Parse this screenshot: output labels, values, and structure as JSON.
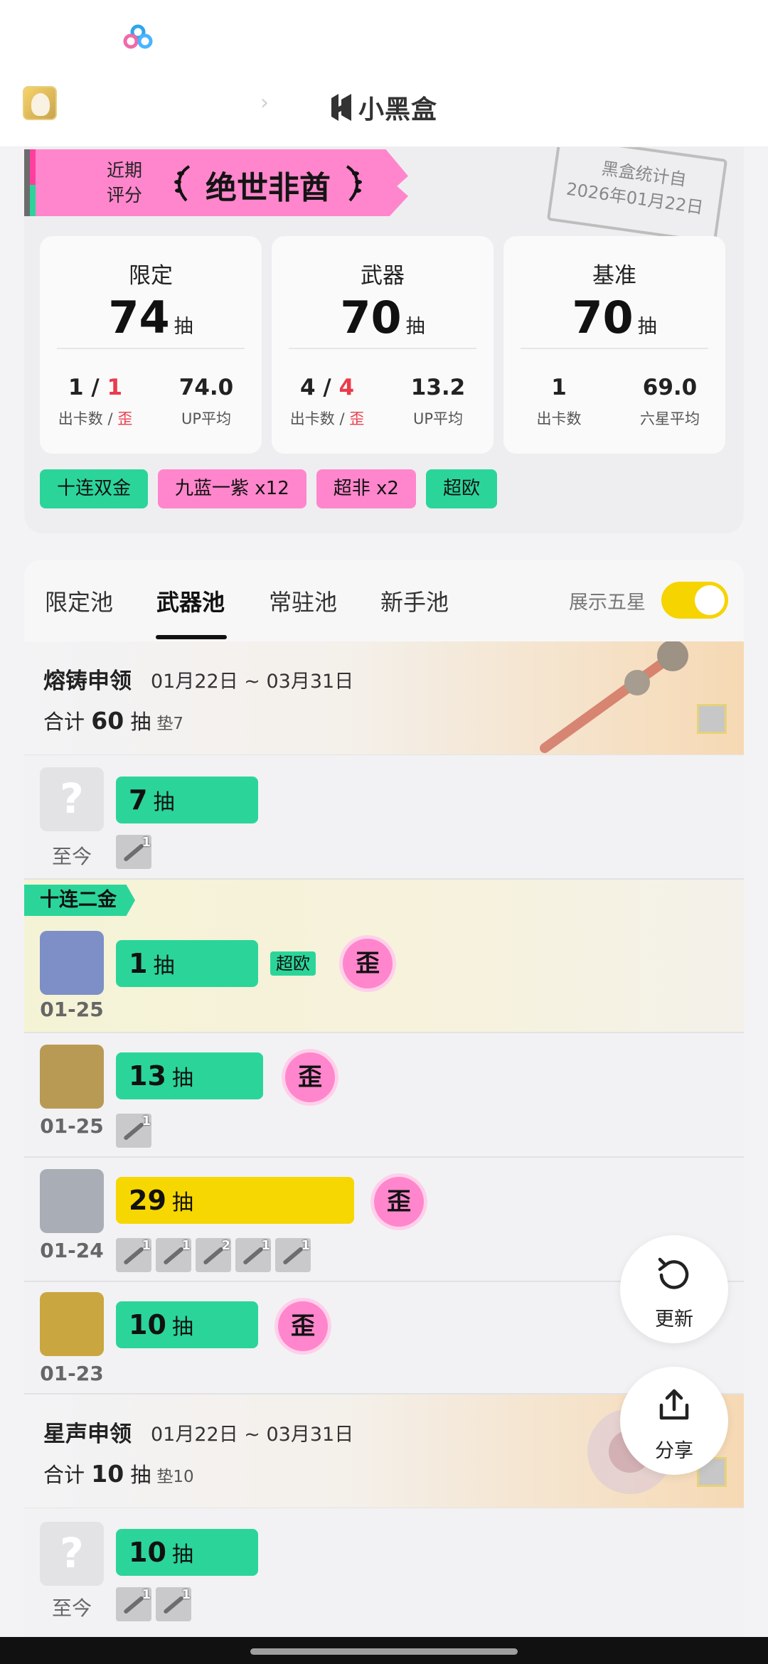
{
  "brand": {
    "name": "小黑盒"
  },
  "stamp": {
    "line1": "黑盒统计自",
    "line2": "2026年01月22日"
  },
  "rating": {
    "label": "近期\n评分",
    "title": "绝世非酋"
  },
  "stats": [
    {
      "name": "限定",
      "count": "74",
      "unit": "抽",
      "left_value_a": "1",
      "left_sep": " / ",
      "left_value_b": "1",
      "left_key_a": "出卡数 / ",
      "left_key_b": "歪",
      "right_value": "74.0",
      "right_key": "UP平均"
    },
    {
      "name": "武器",
      "count": "70",
      "unit": "抽",
      "left_value_a": "4",
      "left_sep": " / ",
      "left_value_b": "4",
      "left_key_a": "出卡数 / ",
      "left_key_b": "歪",
      "right_value": "13.2",
      "right_key": "UP平均"
    },
    {
      "name": "基准",
      "count": "70",
      "unit": "抽",
      "left_value_a": "1",
      "left_sep": "",
      "left_value_b": "",
      "left_key_a": "出卡数",
      "left_key_b": "",
      "right_value": "69.0",
      "right_key": "六星平均"
    }
  ],
  "tags": [
    "十连双金",
    "九蓝一紫 x12",
    "超非 x2",
    "超欧"
  ],
  "tabs": [
    "限定池",
    "武器池",
    "常驻池",
    "新手池"
  ],
  "toggle": {
    "label": "展示五星",
    "on": true
  },
  "pools": [
    {
      "title": "熔铸申领",
      "date": "01月22日 ~ 03月31日",
      "sum_prefix": "合计",
      "sum": "60",
      "unit": "抽",
      "pad": "垫7"
    },
    {
      "title": "星声申领",
      "date": "01月22日 ~ 03月31日",
      "sum_prefix": "合计",
      "sum": "10",
      "unit": "抽",
      "pad": "垫10"
    }
  ],
  "rows": [
    {
      "count": "7",
      "unit": "抽",
      "date": "至今",
      "items": [
        "1"
      ]
    },
    {
      "ribbon": "十连二金",
      "count": "1",
      "unit": "抽",
      "date": "01-25",
      "badge": "超欧",
      "wai": "歪"
    },
    {
      "count": "13",
      "unit": "抽",
      "date": "01-25",
      "wai": "歪",
      "items": [
        "1"
      ]
    },
    {
      "count": "29",
      "unit": "抽",
      "date": "01-24",
      "wai": "歪",
      "items": [
        "1",
        "1",
        "2",
        "1",
        "1"
      ]
    },
    {
      "count": "10",
      "unit": "抽",
      "date": "01-23",
      "wai": "歪"
    },
    {
      "count": "10",
      "unit": "抽",
      "date": "至今",
      "items": [
        "1",
        "1"
      ]
    }
  ],
  "fabs": {
    "refresh": "更新",
    "share": "分享"
  },
  "colors": {
    "green": "#2bd59a",
    "pink": "#ff86cc",
    "yellow": "#f7d702",
    "red": "#ea3b4a"
  }
}
